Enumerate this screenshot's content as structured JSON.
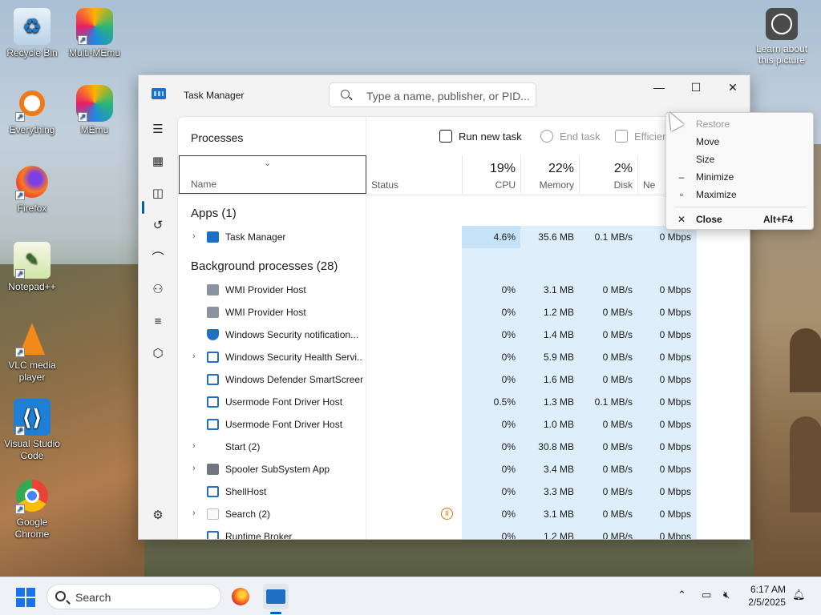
{
  "desktop": {
    "icons": [
      {
        "label": "Recycle Bin",
        "icon": "recycle-bin-icon"
      },
      {
        "label": "Multi-MEmu",
        "icon": "multi-memu-icon"
      },
      {
        "label": "Everything",
        "icon": "everything-search-icon"
      },
      {
        "label": "MEmu",
        "icon": "memu-icon"
      },
      {
        "label": "Firefox",
        "icon": "firefox-icon"
      },
      {
        "label": "Notepad++",
        "icon": "notepad-plus-plus-icon"
      },
      {
        "label": "VLC media player",
        "icon": "vlc-icon"
      },
      {
        "label": "Visual Studio Code",
        "icon": "vscode-icon"
      },
      {
        "label": "Google Chrome",
        "icon": "chrome-icon"
      }
    ],
    "learn": {
      "line1": "Learn about",
      "line2": "this picture"
    }
  },
  "window": {
    "title": "Task Manager",
    "search_placeholder": "Type a name, publisher, or PID...",
    "minimize": "—",
    "maximize": "☐",
    "close": "✕"
  },
  "nav": {
    "items": [
      "menu-icon",
      "processes-icon",
      "performance-icon",
      "app-history-icon",
      "startup-apps-icon",
      "users-icon",
      "details-icon",
      "services-icon",
      "settings-icon"
    ]
  },
  "panel": {
    "title": "Processes",
    "run_new_task": "Run new task",
    "end_task": "End task",
    "efficiency": "Efficien"
  },
  "columns": {
    "name": "Name",
    "status": "Status",
    "cpu_pct": "19%",
    "cpu": "CPU",
    "mem_pct": "22%",
    "mem": "Memory",
    "disk_pct": "2%",
    "disk": "Disk",
    "net": "Ne"
  },
  "groups": {
    "apps": "Apps (1)",
    "background": "Background processes (28)"
  },
  "apps_rows": [
    {
      "name": "Task Manager",
      "cpu": "4.6%",
      "mem": "35.6 MB",
      "disk": "0.1 MB/s",
      "net": "0 Mbps"
    }
  ],
  "bg_rows": [
    {
      "name": "WMI Provider Host",
      "cpu": "0%",
      "mem": "3.1 MB",
      "disk": "0 MB/s",
      "net": "0 Mbps"
    },
    {
      "name": "WMI Provider Host",
      "cpu": "0%",
      "mem": "1.2 MB",
      "disk": "0 MB/s",
      "net": "0 Mbps"
    },
    {
      "name": "Windows Security notification...",
      "cpu": "0%",
      "mem": "1.4 MB",
      "disk": "0 MB/s",
      "net": "0 Mbps"
    },
    {
      "name": "Windows Security Health Servi...",
      "cpu": "0%",
      "mem": "5.9 MB",
      "disk": "0 MB/s",
      "net": "0 Mbps"
    },
    {
      "name": "Windows Defender SmartScreen",
      "cpu": "0%",
      "mem": "1.6 MB",
      "disk": "0 MB/s",
      "net": "0 Mbps"
    },
    {
      "name": "Usermode Font Driver Host",
      "cpu": "0.5%",
      "mem": "1.3 MB",
      "disk": "0.1 MB/s",
      "net": "0 Mbps"
    },
    {
      "name": "Usermode Font Driver Host",
      "cpu": "0%",
      "mem": "1.0 MB",
      "disk": "0 MB/s",
      "net": "0 Mbps"
    },
    {
      "name": "Start (2)",
      "cpu": "0%",
      "mem": "30.8 MB",
      "disk": "0 MB/s",
      "net": "0 Mbps"
    },
    {
      "name": "Spooler SubSystem App",
      "cpu": "0%",
      "mem": "3.4 MB",
      "disk": "0 MB/s",
      "net": "0 Mbps"
    },
    {
      "name": "ShellHost",
      "cpu": "0%",
      "mem": "3.3 MB",
      "disk": "0 MB/s",
      "net": "0 Mbps"
    },
    {
      "name": "Search (2)",
      "cpu": "0%",
      "mem": "3.1 MB",
      "disk": "0 MB/s",
      "net": "0 Mbps"
    },
    {
      "name": "Runtime Broker",
      "cpu": "0%",
      "mem": "1.2 MB",
      "disk": "0 MB/s",
      "net": "0 Mbps"
    }
  ],
  "context_menu": {
    "restore": "Restore",
    "move": "Move",
    "size": "Size",
    "minimize": "Minimize",
    "maximize": "Maximize",
    "close": "Close",
    "close_shortcut": "Alt+F4"
  },
  "taskbar": {
    "search": "Search",
    "time": "6:17 AM",
    "date": "2/5/2025"
  },
  "colors": {
    "accent": "#005fb8",
    "heat_light": "#deeefa",
    "heat_strong": "#c5e2f8"
  }
}
